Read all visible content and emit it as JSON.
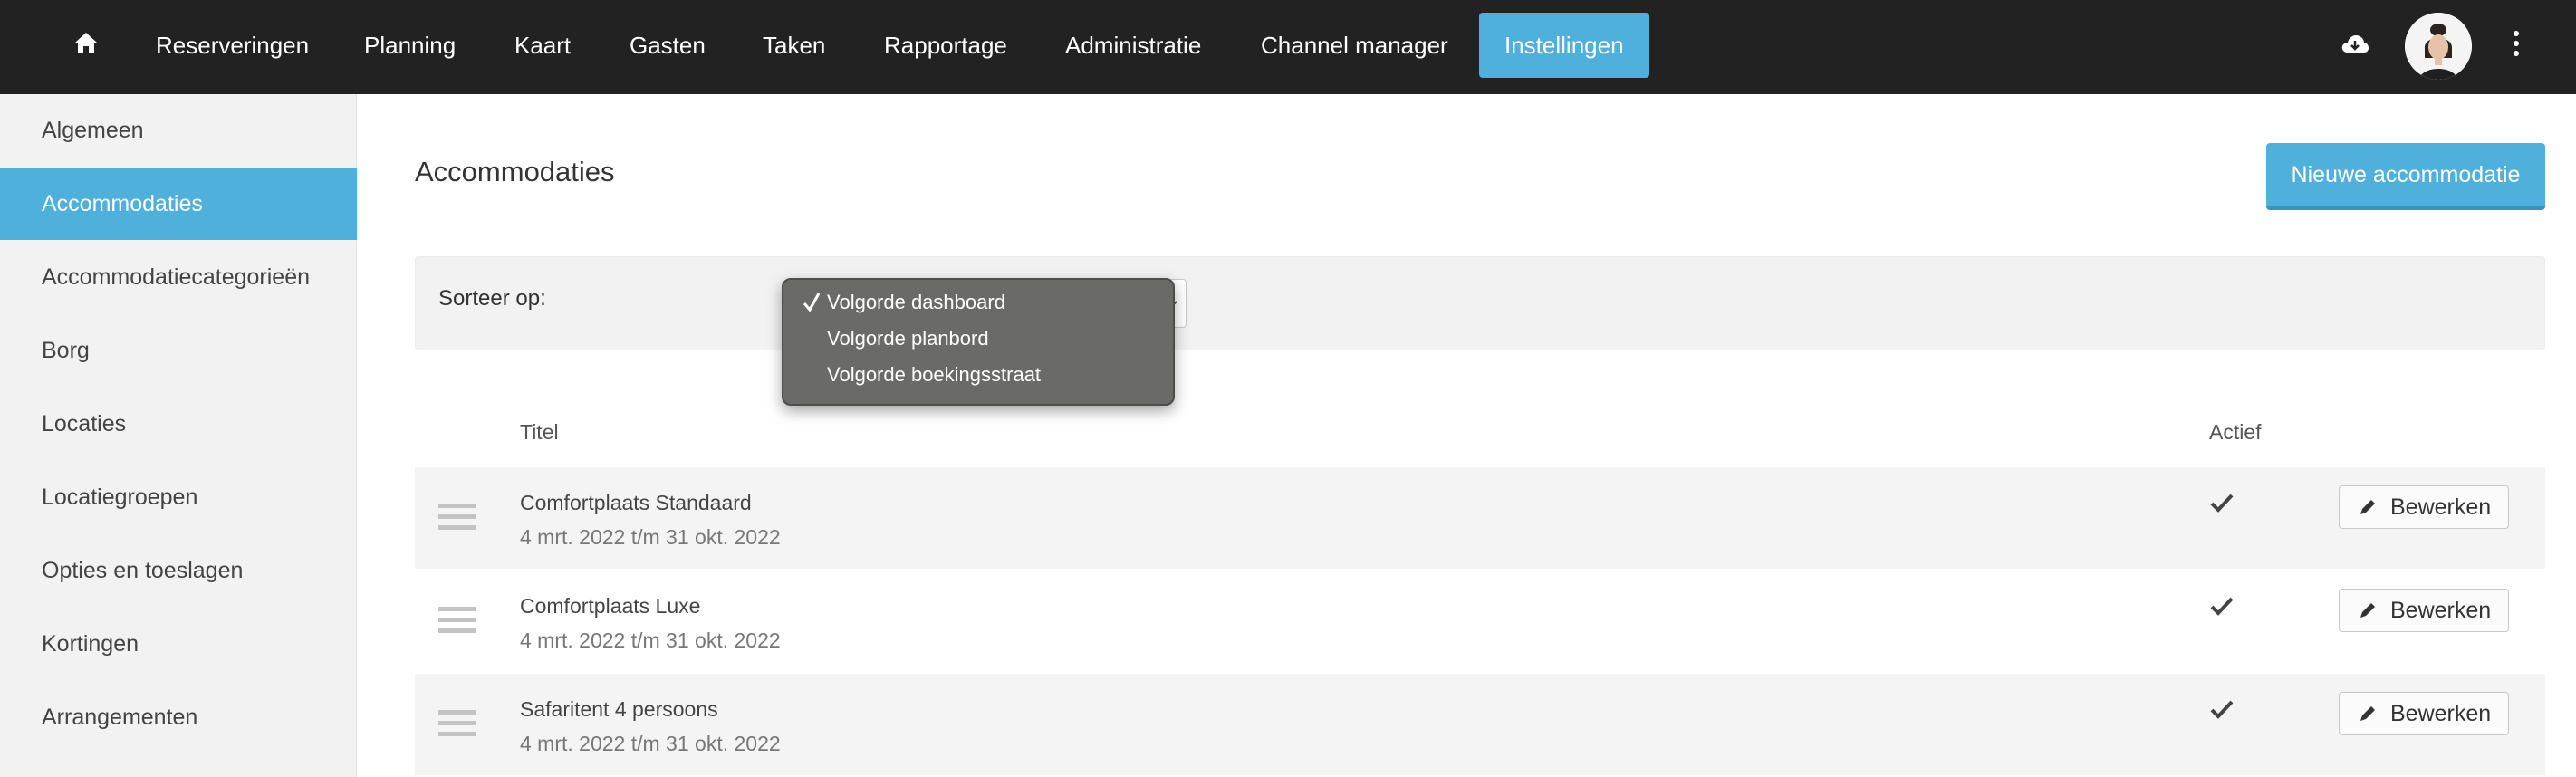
{
  "nav": {
    "items": [
      {
        "label": "Reserveringen"
      },
      {
        "label": "Planning"
      },
      {
        "label": "Kaart"
      },
      {
        "label": "Gasten"
      },
      {
        "label": "Taken"
      },
      {
        "label": "Rapportage"
      },
      {
        "label": "Administratie"
      },
      {
        "label": "Channel manager"
      },
      {
        "label": "Instellingen",
        "active": true
      }
    ],
    "icons": [
      "home-icon",
      "cloud-download-icon",
      "avatar",
      "kebab-menu-icon"
    ]
  },
  "sidebar": {
    "items": [
      {
        "label": "Algemeen"
      },
      {
        "label": "Accommodaties",
        "active": true
      },
      {
        "label": "Accommodatiecategorieën"
      },
      {
        "label": "Borg"
      },
      {
        "label": "Locaties"
      },
      {
        "label": "Locatiegroepen"
      },
      {
        "label": "Opties en toeslagen"
      },
      {
        "label": "Kortingen"
      },
      {
        "label": "Arrangementen"
      }
    ]
  },
  "main": {
    "title": "Accommodaties",
    "new_button": "Nieuwe accommodatie",
    "sort": {
      "label": "Sorteer op:",
      "options": [
        "Volgorde dashboard",
        "Volgorde planbord",
        "Volgorde boekingsstraat"
      ],
      "selected": "Volgorde dashboard"
    },
    "table": {
      "headers": {
        "title": "Titel",
        "active": "Actief"
      },
      "edit_label": "Bewerken",
      "rows": [
        {
          "title": "Comfortplaats Standaard",
          "dates": "4 mrt. 2022 t/m 31 okt. 2022",
          "active": true
        },
        {
          "title": "Comfortplaats Luxe",
          "dates": "4 mrt. 2022 t/m 31 okt. 2022",
          "active": true
        },
        {
          "title": "Safaritent 4 persoons",
          "dates": "4 mrt. 2022 t/m 31 okt. 2022",
          "active": true
        }
      ]
    }
  },
  "colors": {
    "topbar": "#222222",
    "accent": "#4fb0dc",
    "sidebar_bg": "#f2f2f2",
    "dropdown_bg": "#6a6a69"
  }
}
